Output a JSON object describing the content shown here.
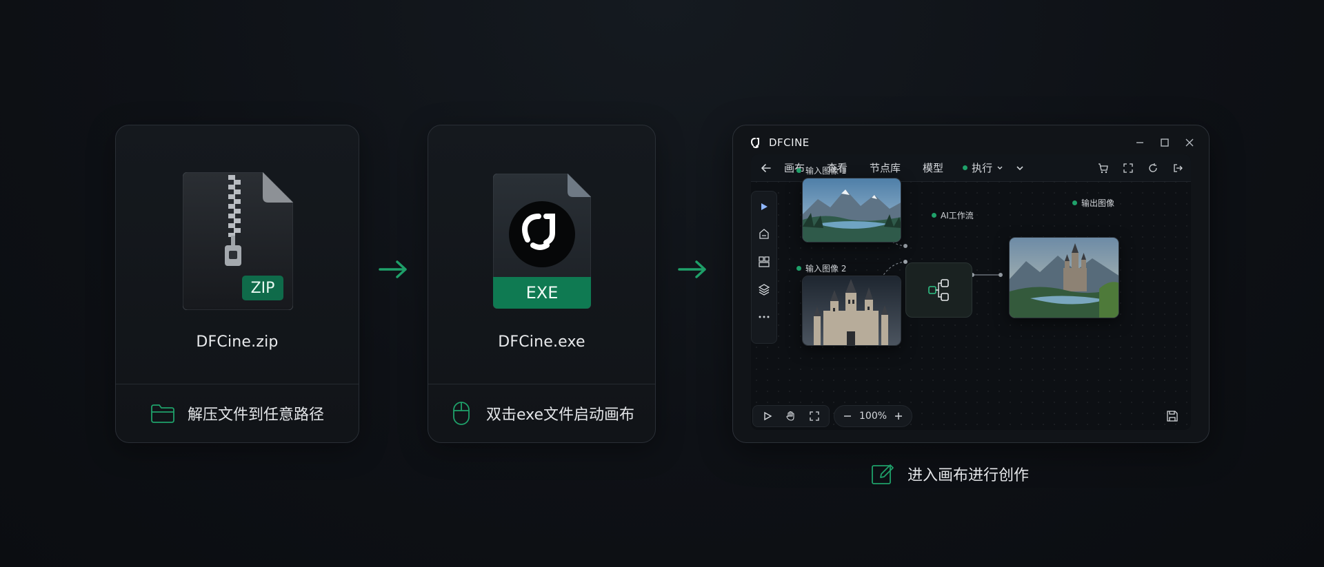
{
  "steps": {
    "zip": {
      "badge": "ZIP",
      "file_name": "DFCine.zip",
      "instruction": "解压文件到任意路径",
      "icon": "folder-icon"
    },
    "exe": {
      "badge": "EXE",
      "file_name": "DFCine.exe",
      "instruction": "双击exe文件启动画布",
      "icon": "mouse-icon"
    },
    "canvas": {
      "instruction": "进入画布进行创作",
      "icon": "edit-icon"
    }
  },
  "app": {
    "title": "DFCINE",
    "window_controls": [
      "minimize-icon",
      "maximize-icon",
      "close-icon"
    ],
    "menu": [
      "画布",
      "查看",
      "节点库",
      "模型"
    ],
    "run_label": "执行",
    "toolbar_right_icons": [
      "cart-icon",
      "expand-icon",
      "refresh-icon",
      "exit-icon"
    ],
    "side_tools": [
      "play-pointer-icon",
      "node-add-icon",
      "layout-icon",
      "layers-icon",
      "more-icon"
    ],
    "nodes": {
      "input1": "输入图像 1",
      "input2": "输入图像 2",
      "workflow": "AI工作流",
      "output": "输出图像"
    },
    "zoom": "100%"
  },
  "colors": {
    "accent": "#1fa16a",
    "accent_dark": "#0f6b4a",
    "background": "#0e1116",
    "card": "#15191e"
  }
}
